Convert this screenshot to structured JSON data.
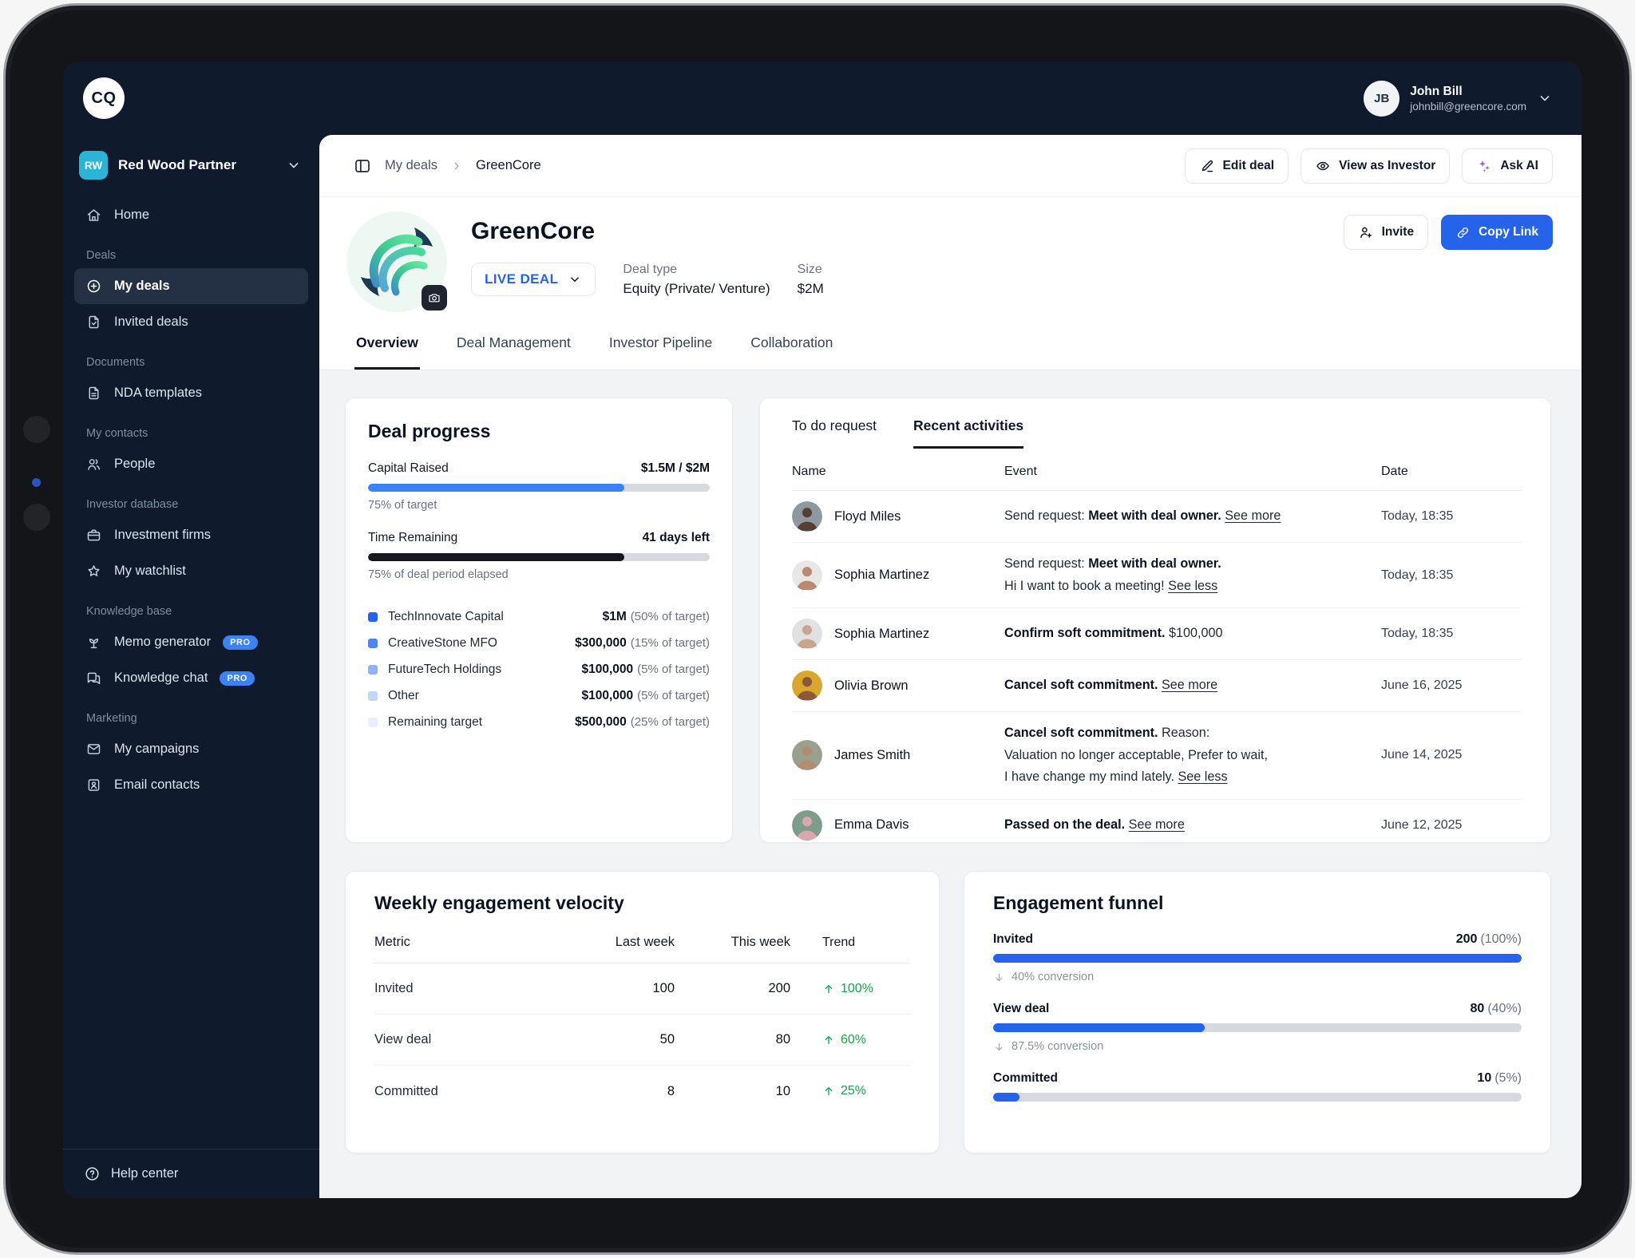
{
  "colors": {
    "navy": "#0f1b2d",
    "accent": "#2563eb",
    "bar_blue": "#3b82f6",
    "bar_dark": "#16181d",
    "green": "#17a34a",
    "purple": "#8b5cf6",
    "workspace_badge": "#2cb4d6"
  },
  "topbar": {
    "logo_text": "CQ",
    "user": {
      "initials": "JB",
      "name": "John Bill",
      "email": "johnbill@greencore.com"
    }
  },
  "sidebar": {
    "workspace": {
      "initials": "RW",
      "name": "Red Wood Partner"
    },
    "sections": [
      {
        "label": "",
        "items": [
          {
            "icon": "home",
            "label": "Home"
          }
        ]
      },
      {
        "label": "Deals",
        "items": [
          {
            "icon": "deal",
            "label": "My deals",
            "active": true
          },
          {
            "icon": "invited",
            "label": "Invited deals"
          }
        ]
      },
      {
        "label": "Documents",
        "items": [
          {
            "icon": "file",
            "label": "NDA templates"
          }
        ]
      },
      {
        "label": "My contacts",
        "items": [
          {
            "icon": "users",
            "label": "People"
          }
        ]
      },
      {
        "label": "Investor database",
        "items": [
          {
            "icon": "briefcase",
            "label": "Investment firms"
          },
          {
            "icon": "star",
            "label": "My watchlist"
          }
        ]
      },
      {
        "label": "Knowledge base",
        "items": [
          {
            "icon": "sprout",
            "label": "Memo generator",
            "badge": "PRO"
          },
          {
            "icon": "chat",
            "label": "Knowledge chat",
            "badge": "PRO"
          }
        ]
      },
      {
        "label": "Marketing",
        "items": [
          {
            "icon": "mail",
            "label": "My campaigns"
          },
          {
            "icon": "contact",
            "label": "Email contacts"
          }
        ]
      }
    ],
    "footer": {
      "icon": "help",
      "label": "Help center"
    }
  },
  "header": {
    "breadcrumb": {
      "parent": "My deals",
      "current": "GreenCore"
    },
    "actions": [
      {
        "icon": "pencil",
        "label": "Edit deal"
      },
      {
        "icon": "eye",
        "label": "View as Investor"
      },
      {
        "icon": "sparkles",
        "label": "Ask AI"
      }
    ]
  },
  "deal": {
    "name": "GreenCore",
    "status": "LIVE DEAL",
    "deal_type_label": "Deal type",
    "deal_type": "Equity (Private/ Venture)",
    "size_label": "Size",
    "size": "$2M",
    "invite_label": "Invite",
    "copy_link_label": "Copy Link"
  },
  "tabs": [
    {
      "label": "Overview",
      "active": true
    },
    {
      "label": "Deal Management"
    },
    {
      "label": "Investor Pipeline"
    },
    {
      "label": "Collaboration"
    }
  ],
  "deal_progress": {
    "title": "Deal progress",
    "bars": [
      {
        "label": "Capital Raised",
        "value": "$1.5M / $2M",
        "percent": 75,
        "caption": "75% of target",
        "color": "#3b82f6"
      },
      {
        "label": "Time Remaining",
        "value": "41 days left",
        "percent": 75,
        "caption": "75% of deal period elapsed",
        "color": "#16181d"
      }
    ],
    "legend": [
      {
        "name": "TechInnovate Capital",
        "amount": "$1M",
        "note": "(50% of target)",
        "color": "#2563eb"
      },
      {
        "name": "CreativeStone MFO",
        "amount": "$300,000",
        "note": "(15% of target)",
        "color": "#4e83f3"
      },
      {
        "name": "FutureTech Holdings",
        "amount": "$100,000",
        "note": "(5% of target)",
        "color": "#8fb3f9"
      },
      {
        "name": "Other",
        "amount": "$100,000",
        "note": "(5% of target)",
        "color": "#c3d7fc"
      },
      {
        "name": "Remaining target",
        "amount": "$500,000",
        "note": "(25% of target)",
        "color": "#e7effd"
      }
    ]
  },
  "activities": {
    "tabs": [
      {
        "label": "To do request"
      },
      {
        "label": "Recent activities",
        "active": true
      }
    ],
    "columns": {
      "name": "Name",
      "event": "Event",
      "date": "Date"
    },
    "rows": [
      {
        "name": "Floyd Miles",
        "date": "Today, 18:35",
        "avatar": {
          "bg": "#8f989f",
          "fg": "#553f33"
        },
        "lines": [
          [
            {
              "t": "Send request: "
            },
            {
              "t": "Meet with deal owner.",
              "s": "b"
            },
            {
              "t": " "
            },
            {
              "t": "See more",
              "s": "l"
            }
          ]
        ]
      },
      {
        "name": "Sophia Martinez",
        "date": "Today, 18:35",
        "avatar": {
          "bg": "#e9e7e5",
          "fg": "#b98a72"
        },
        "lines": [
          [
            {
              "t": "Send request: "
            },
            {
              "t": "Meet with deal owner.",
              "s": "b"
            }
          ],
          [
            {
              "t": "Hi I want to book a meeting! "
            },
            {
              "t": "See less",
              "s": "l"
            }
          ]
        ]
      },
      {
        "name": "Sophia Martinez",
        "date": "Today, 18:35",
        "avatar": {
          "bg": "#dfe1e3",
          "fg": "#caa58d"
        },
        "lines": [
          [
            {
              "t": "Confirm soft commitment.",
              "s": "b"
            },
            {
              "t": " $100,000"
            }
          ]
        ]
      },
      {
        "name": "Olivia Brown",
        "date": "June 16, 2025",
        "avatar": {
          "bg": "#d9a62e",
          "fg": "#8a5a38"
        },
        "lines": [
          [
            {
              "t": "Cancel soft commitment.",
              "s": "b"
            },
            {
              "t": " "
            },
            {
              "t": "See more",
              "s": "l"
            }
          ]
        ]
      },
      {
        "name": "James Smith",
        "date": "June 14, 2025",
        "avatar": {
          "bg": "#9aa08e",
          "fg": "#b08d6e"
        },
        "lines": [
          [
            {
              "t": "Cancel soft commitment.",
              "s": "b"
            },
            {
              "t": " Reason:"
            }
          ],
          [
            {
              "t": "Valuation no longer acceptable, Prefer to wait,"
            }
          ],
          [
            {
              "t": "I have change my mind lately. "
            },
            {
              "t": "See less",
              "s": "l"
            }
          ]
        ]
      },
      {
        "name": "Emma Davis",
        "date": "June 12, 2025",
        "avatar": {
          "bg": "#7f9c8a",
          "fg": "#d8a7b0"
        },
        "lines": [
          [
            {
              "t": "Passed on the deal.",
              "s": "b"
            },
            {
              "t": " "
            },
            {
              "t": "See more",
              "s": "l"
            }
          ]
        ]
      }
    ]
  },
  "velocity": {
    "title": "Weekly engagement velocity",
    "columns": {
      "metric": "Metric",
      "last": "Last week",
      "this": "This week",
      "trend": "Trend"
    },
    "rows": [
      {
        "metric": "Invited",
        "last": "100",
        "this": "200",
        "trend": "100%"
      },
      {
        "metric": "View deal",
        "last": "50",
        "this": "80",
        "trend": "60%"
      },
      {
        "metric": "Committed",
        "last": "8",
        "this": "10",
        "trend": "25%"
      }
    ]
  },
  "funnel": {
    "title": "Engagement funnel",
    "stages": [
      {
        "label": "Invited",
        "value": "200",
        "pct": "(100%)",
        "percent": 100,
        "conversion": "40% conversion"
      },
      {
        "label": "View deal",
        "value": "80",
        "pct": "(40%)",
        "percent": 40,
        "conversion": "87.5% conversion"
      },
      {
        "label": "Committed",
        "value": "10",
        "pct": "(5%)",
        "percent": 5,
        "conversion": null
      }
    ]
  }
}
